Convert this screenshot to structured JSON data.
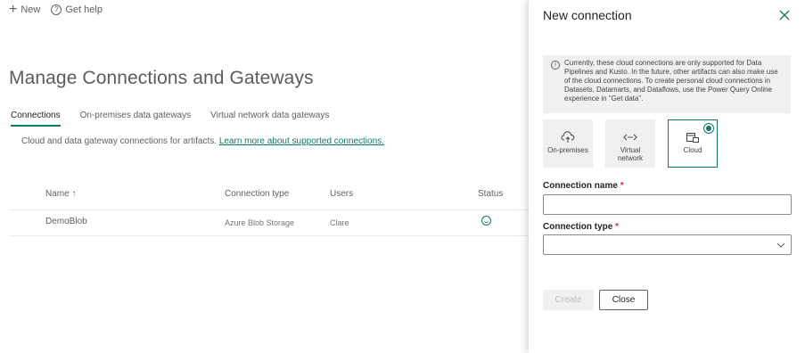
{
  "toolbar": {
    "new_label": "New",
    "help_label": "Get help"
  },
  "page": {
    "title": "Manage Connections and Gateways",
    "tabs": [
      {
        "label": "Connections",
        "active": true
      },
      {
        "label": "On-premises data gateways",
        "active": false
      },
      {
        "label": "Virtual network data gateways",
        "active": false
      }
    ],
    "description": "Cloud and data gateway connections for artifacts.",
    "learn_more": "Learn more about supported connections."
  },
  "table": {
    "columns": [
      "Name ↑",
      "Connection type",
      "Users",
      "Status"
    ],
    "rows": [
      {
        "name": "DemoBlob",
        "type": "Azure Blob Storage",
        "users": "Clare",
        "status": "status-ok-icon"
      }
    ]
  },
  "panel": {
    "title": "New connection",
    "info_text": "Currently, these cloud connections are only supported for Data Pipelines and Kusto. In the future, other artifacts can also make use of the cloud connections. To create personal cloud connections in Datasets, Datamarts, and Dataflows, use the Power Query Online experience in \"Get data\".",
    "cards": [
      {
        "label": "On-premises",
        "icon": "cloud-upload-icon",
        "selected": false
      },
      {
        "label": "Virtual network",
        "icon": "vnet-icon",
        "selected": false
      },
      {
        "label": "Cloud",
        "icon": "cloud-connection-icon",
        "selected": true
      }
    ],
    "connection_name_label": "Connection name",
    "connection_name_value": "",
    "connection_type_label": "Connection type",
    "connection_type_value": "",
    "required_mark": "*",
    "create_label": "Create",
    "close_label": "Close"
  },
  "colors": {
    "accent": "#117865",
    "required": "#c4314b"
  }
}
